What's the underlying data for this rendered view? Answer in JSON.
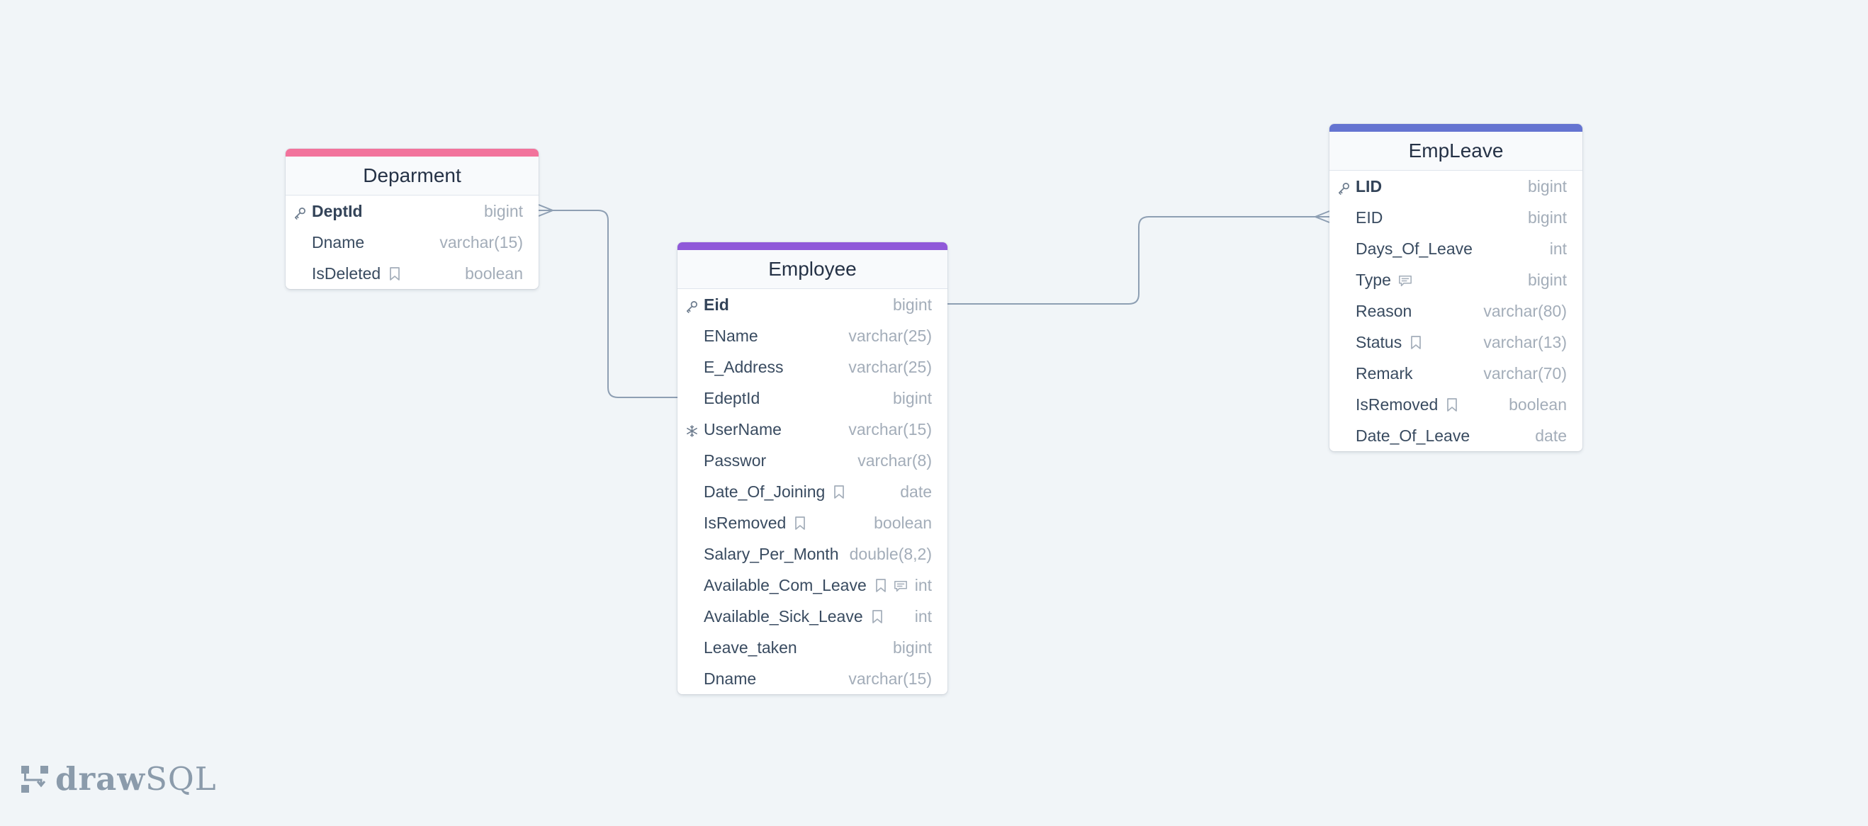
{
  "app": {
    "brand_bold": "draw",
    "brand_light": "SQL"
  },
  "tables": [
    {
      "name": "Deparment",
      "accent": "#f2739c",
      "columns": [
        {
          "name": "DeptId",
          "type": "bigint",
          "pk": true,
          "icon": "key-icon"
        },
        {
          "name": "Dname",
          "type": "varchar(15)"
        },
        {
          "name": "IsDeleted",
          "type": "boolean",
          "flags": [
            "bookmark-icon"
          ]
        }
      ]
    },
    {
      "name": "Employee",
      "accent": "#9059d9",
      "columns": [
        {
          "name": "Eid",
          "type": "bigint",
          "pk": true,
          "icon": "key-icon"
        },
        {
          "name": "EName",
          "type": "varchar(25)"
        },
        {
          "name": "E_Address",
          "type": "varchar(25)"
        },
        {
          "name": "EdeptId",
          "type": "bigint"
        },
        {
          "name": "UserName",
          "type": "varchar(15)",
          "icon": "snowflake-icon"
        },
        {
          "name": "Passwor",
          "type": "varchar(8)"
        },
        {
          "name": "Date_Of_Joining",
          "type": "date",
          "flags": [
            "bookmark-icon"
          ]
        },
        {
          "name": "IsRemoved",
          "type": "boolean",
          "flags": [
            "bookmark-icon"
          ]
        },
        {
          "name": "Salary_Per_Month",
          "type": "double(8,2)"
        },
        {
          "name": "Available_Com_Leave",
          "type": "int",
          "flags": [
            "bookmark-icon",
            "comment-icon"
          ]
        },
        {
          "name": "Available_Sick_Leave",
          "type": "int",
          "flags": [
            "bookmark-icon"
          ]
        },
        {
          "name": "Leave_taken",
          "type": "bigint"
        },
        {
          "name": "Dname",
          "type": "varchar(15)"
        }
      ]
    },
    {
      "name": "EmpLeave",
      "accent": "#6574d1",
      "columns": [
        {
          "name": "LID",
          "type": "bigint",
          "pk": true,
          "icon": "key-icon"
        },
        {
          "name": "EID",
          "type": "bigint"
        },
        {
          "name": "Days_Of_Leave",
          "type": "int"
        },
        {
          "name": "Type",
          "type": "bigint",
          "flags": [
            "comment-icon"
          ]
        },
        {
          "name": "Reason",
          "type": "varchar(80)"
        },
        {
          "name": "Status",
          "type": "varchar(13)",
          "flags": [
            "bookmark-icon"
          ]
        },
        {
          "name": "Remark",
          "type": "varchar(70)"
        },
        {
          "name": "IsRemoved",
          "type": "boolean",
          "flags": [
            "bookmark-icon"
          ]
        },
        {
          "name": "Date_Of_Leave",
          "type": "date"
        }
      ]
    }
  ],
  "relations": [
    {
      "from_table": "Deparment",
      "from_column": "DeptId",
      "to_table": "Employee",
      "to_column": "EdeptId",
      "many_end": "Deparment"
    },
    {
      "from_table": "Employee",
      "from_column": "Eid",
      "to_table": "EmpLeave",
      "to_column": "EID",
      "many_end": "EmpLeave"
    }
  ],
  "colors": {
    "background": "#f1f5f8",
    "relation_line": "#8e9fb3"
  }
}
